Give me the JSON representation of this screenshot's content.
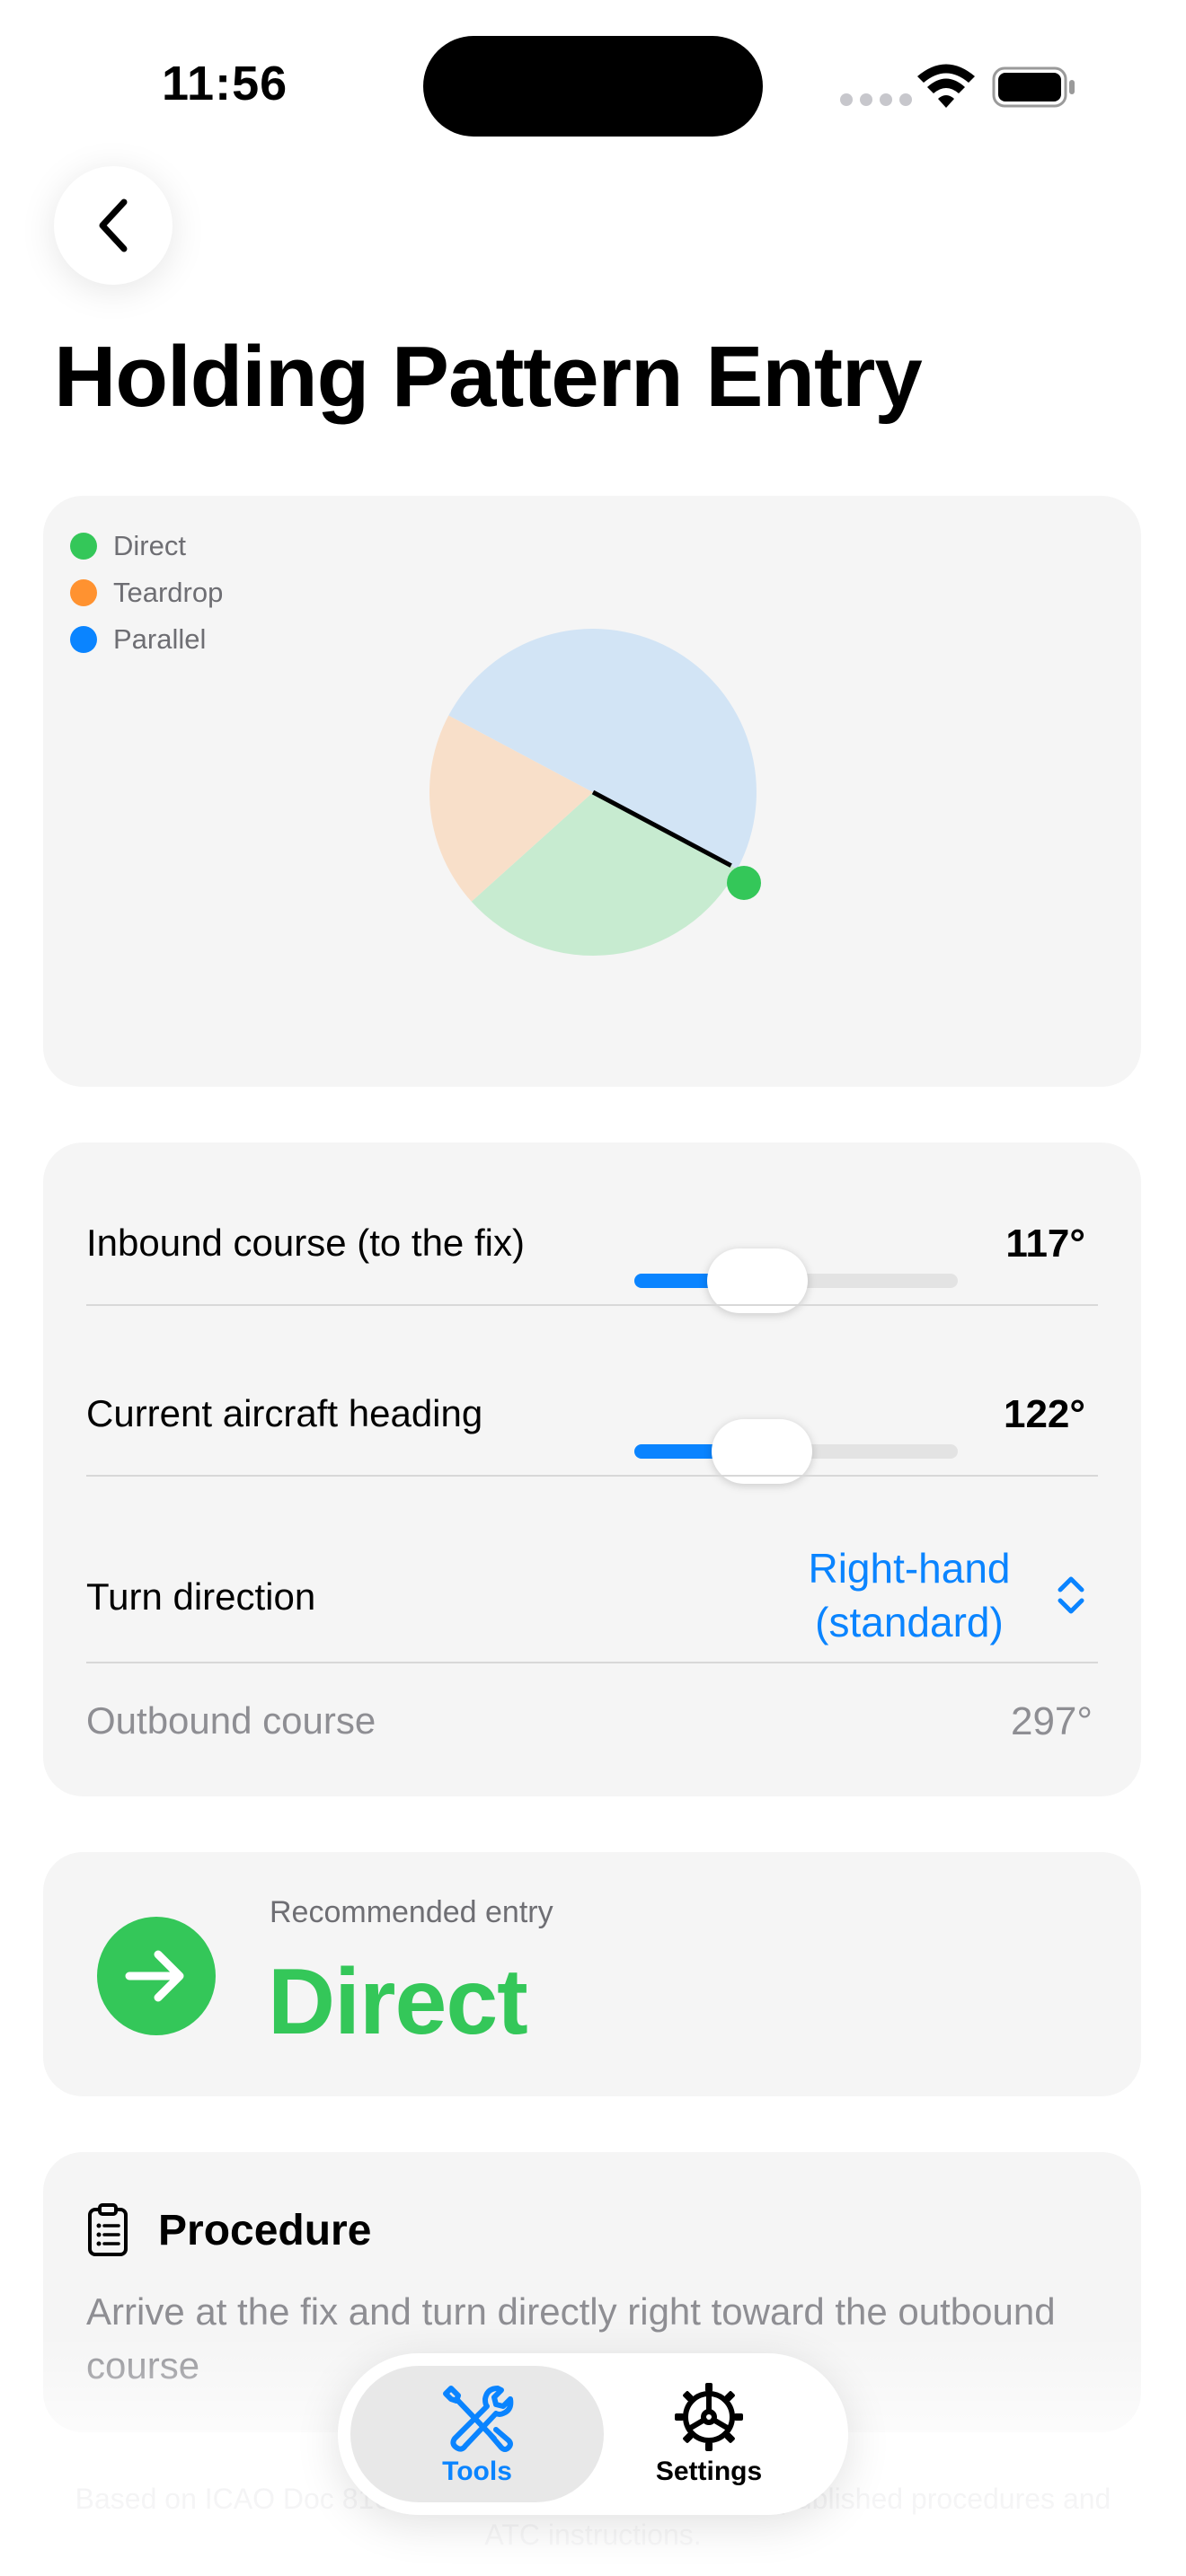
{
  "status_bar": {
    "time": "11:56"
  },
  "header": {
    "title": "Holding Pattern Entry"
  },
  "colors": {
    "direct": "#34c759",
    "teardrop": "#ff9230",
    "parallel": "#0a84ff",
    "direct_sector": "#c7ebd0",
    "teardrop_sector": "#f8dfc9",
    "parallel_sector": "#d2e4f5"
  },
  "chart": {
    "legend": [
      {
        "label": "Direct",
        "color": "#34c759"
      },
      {
        "label": "Teardrop",
        "color": "#ff9230"
      },
      {
        "label": "Parallel",
        "color": "#0a84ff"
      }
    ]
  },
  "chart_data": {
    "type": "pie",
    "categories": [
      "Direct",
      "Teardrop",
      "Parallel"
    ],
    "values": [
      110,
      70,
      180
    ],
    "inbound_course_deg": 117,
    "aircraft_heading_deg": 122
  },
  "inputs": {
    "inbound": {
      "label": "Inbound course (to the fix)",
      "value": "117°",
      "slider_fraction": 0.325
    },
    "heading": {
      "label": "Current aircraft heading",
      "value": "122°",
      "slider_fraction": 0.339
    },
    "turn": {
      "label": "Turn direction",
      "value_line1": "Right-hand",
      "value_line2": "(standard)"
    },
    "outbound": {
      "label": "Outbound course",
      "value": "297°"
    }
  },
  "result": {
    "caption": "Recommended entry",
    "value": "Direct",
    "icon": "arrow-right-icon"
  },
  "procedure": {
    "title": "Procedure",
    "icon": "clipboard-list-icon",
    "text": "Arrive at the fix and turn directly right toward the outbound course"
  },
  "footnote": "Based on ICAO Doc 8168 guidance. Always verify with published procedures and ATC instructions.",
  "tab_bar": {
    "tabs": [
      {
        "label": "Tools",
        "icon": "tools-icon",
        "selected": true
      },
      {
        "label": "Settings",
        "icon": "gear-icon",
        "selected": false
      }
    ]
  }
}
